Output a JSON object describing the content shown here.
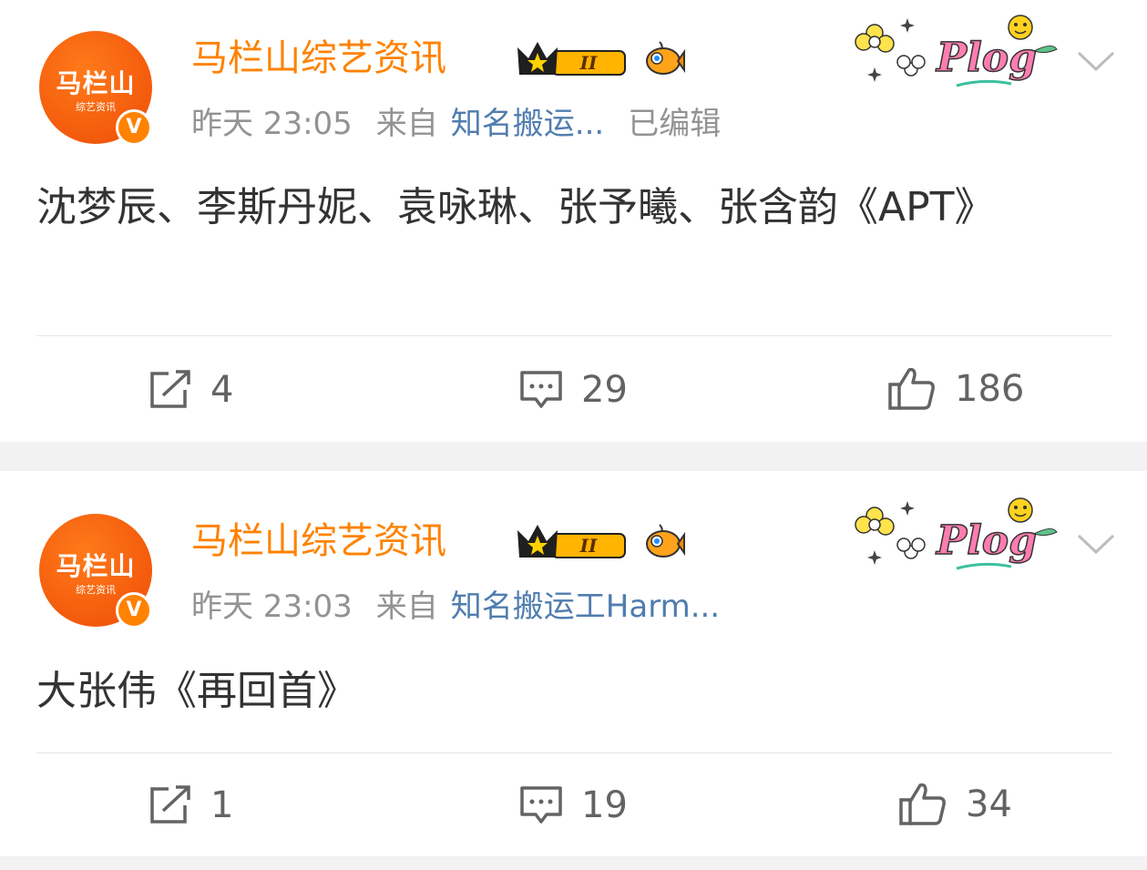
{
  "posts": [
    {
      "username": "马栏山综艺资讯",
      "avatar_line1": "马栏山",
      "avatar_line2": "综艺资讯",
      "verified_mark": "V",
      "time": "昨天 23:05",
      "from_label": "来自",
      "source": "知名搬运...",
      "edited": "已编辑",
      "content": "沈梦辰、李斯丹妮、袁咏琳、张予曦、张含韵《APT》",
      "repost_count": "4",
      "comment_count": "29",
      "like_count": "186"
    },
    {
      "username": "马栏山综艺资讯",
      "avatar_line1": "马栏山",
      "avatar_line2": "综艺资讯",
      "verified_mark": "V",
      "time": "昨天 23:03",
      "from_label": "来自",
      "source": "知名搬运工Harm...",
      "edited": "",
      "content": "大张伟《再回首》",
      "repost_count": "1",
      "comment_count": "19",
      "like_count": "34"
    }
  ],
  "badge": {
    "level": "II",
    "sticker_text": "Plog"
  },
  "colors": {
    "username": "#ff8200",
    "source": "#507daf",
    "meta": "#939393",
    "text": "#333333",
    "icon": "#636363"
  }
}
